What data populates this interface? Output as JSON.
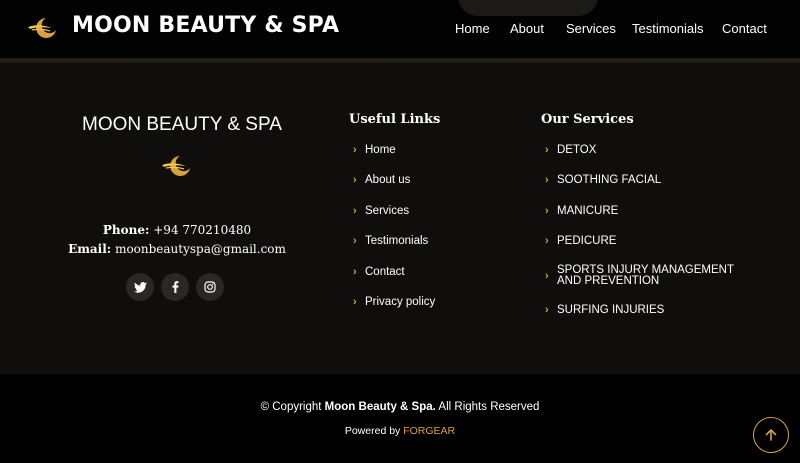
{
  "header": {
    "brand": "MOON BEAUTY & SPA",
    "nav": [
      "Home",
      "About",
      "Services",
      "Testimonials",
      "Contact"
    ]
  },
  "footer": {
    "brand": "MOON BEAUTY & SPA",
    "contact": {
      "phone_label": "Phone:",
      "phone": "+94 770210480",
      "email_label": "Email:",
      "email": "moonbeautyspa@gmail.com"
    },
    "social_icons": [
      "twitter-icon",
      "facebook-icon",
      "instagram-icon"
    ],
    "useful_links": {
      "title": "Useful Links",
      "items": [
        "Home",
        "About us",
        "Services",
        "Testimonials",
        "Contact",
        "Privacy policy"
      ]
    },
    "services": {
      "title": "Our Services",
      "items": [
        "DETOX",
        "SOOTHING FACIAL",
        "MANICURE",
        "PEDICURE",
        "SPORTS INJURY MANAGEMENT AND PREVENTION",
        "SURFING INJURIES"
      ]
    },
    "copyright": {
      "prefix": "© Copyright",
      "company": "Moon Beauty & Spa.",
      "suffix": "All Rights Reserved"
    },
    "powered": {
      "prefix": "Powered by",
      "name": "FORGEAR"
    }
  },
  "colors": {
    "accent": "#d9a238",
    "header_bg": "#020202",
    "footer_bg": "#0f0e0d",
    "bottom_bg": "#000000"
  }
}
